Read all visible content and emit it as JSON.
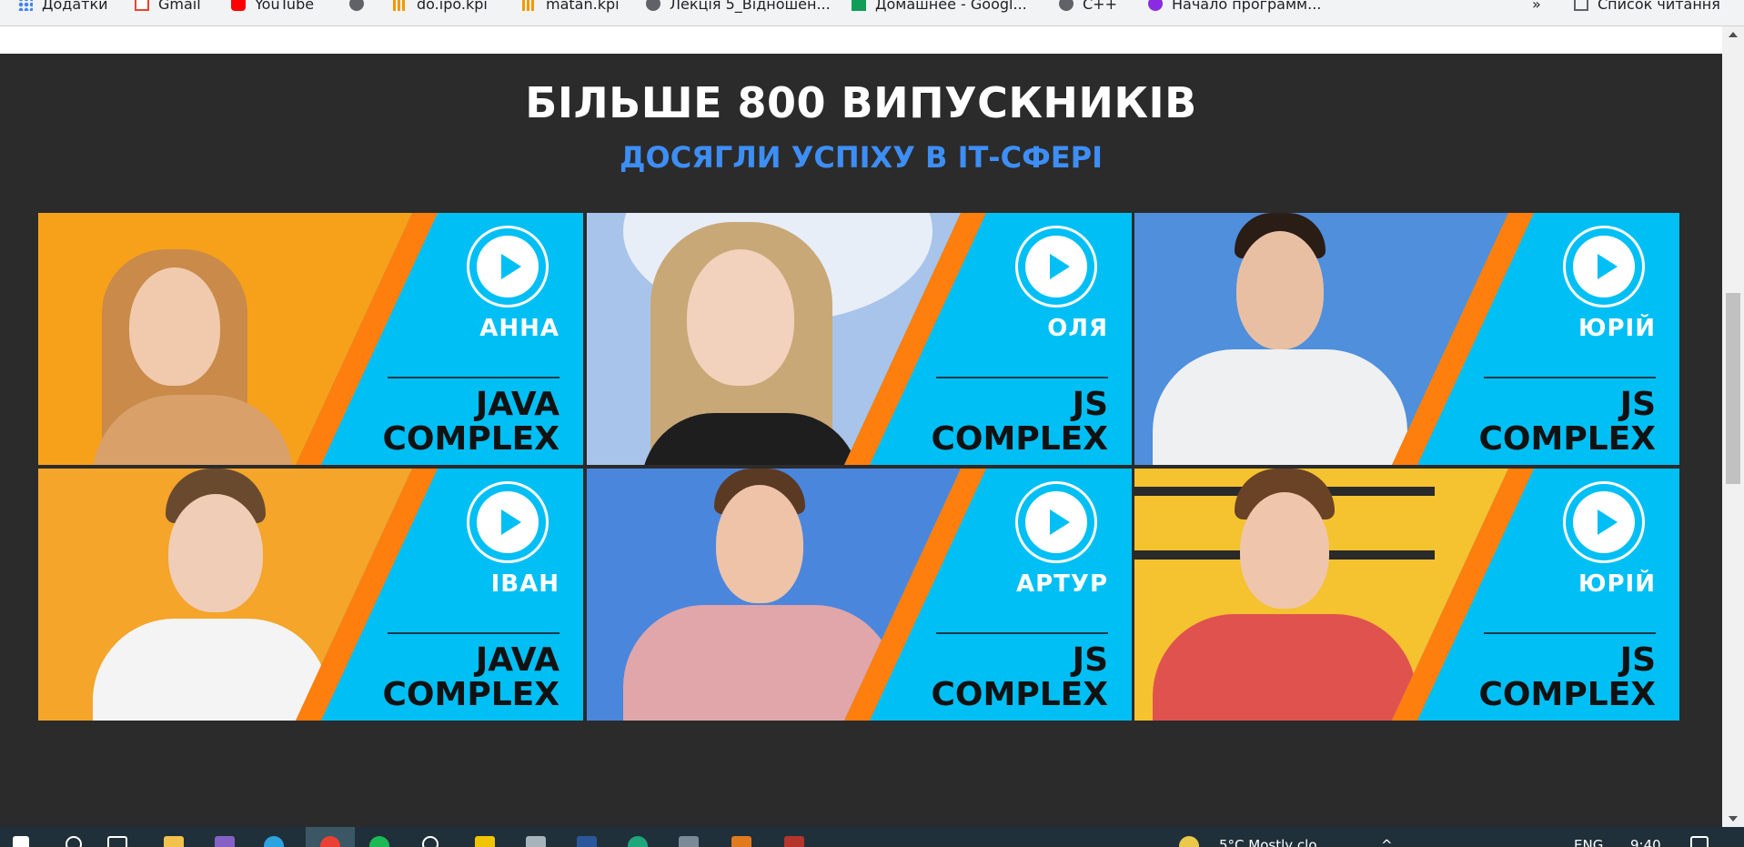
{
  "bookmarks": [
    {
      "label": "Додатки",
      "icon": "apps-grid-icon"
    },
    {
      "label": "Gmail",
      "icon": "gmail-icon"
    },
    {
      "label": "YouTube",
      "icon": "youtube-icon"
    },
    {
      "label": "",
      "icon": "globe-icon"
    },
    {
      "label": "do.ipo.kpi",
      "icon": "moodle-icon"
    },
    {
      "label": "matan.kpi",
      "icon": "moodle-icon"
    },
    {
      "label": "Лекція 5_Відношен...",
      "icon": "globe-icon"
    },
    {
      "label": "Домашнее - Googl...",
      "icon": "google-sheets-icon"
    },
    {
      "label": "C++",
      "icon": "cpp-icon"
    },
    {
      "label": "Начало программ...",
      "icon": "purple-circle-icon"
    }
  ],
  "bookmarks_more": "»",
  "reading_list": "Список читання",
  "heading": {
    "title": "БІЛЬШЕ 800 ВИПУСКНИКІВ",
    "subtitle": "ДОСЯГЛИ УСПІХУ В ІТ-СФЕРІ"
  },
  "colors": {
    "background": "#2b2b2b",
    "subtitle": "#3d8ef5",
    "card_blue": "#00bff4",
    "stripe_orange": "#ff7f0e"
  },
  "graduates": [
    {
      "name": "АННА",
      "course_line1": "JAVA",
      "course_line2": "COMPLEX",
      "photo_bg": "#f7a11a"
    },
    {
      "name": "ОЛЯ",
      "course_line1": "JS",
      "course_line2": "COMPLEX",
      "photo_bg": "#a9c4ea"
    },
    {
      "name": "ЮРІЙ",
      "course_line1": "JS",
      "course_line2": "COMPLEX",
      "photo_bg": "#4f8fdc"
    },
    {
      "name": "ІВАН",
      "course_line1": "JAVA",
      "course_line2": "COMPLEX",
      "photo_bg": "#f4a52a"
    },
    {
      "name": "АРТУР",
      "course_line1": "JS",
      "course_line2": "COMPLEX",
      "photo_bg": "#4b86dd"
    },
    {
      "name": "ЮРІЙ",
      "course_line1": "JS",
      "course_line2": "COMPLEX",
      "photo_bg": "#f5c230"
    }
  ],
  "taskbar": {
    "weather": "5°C  Mostly clo",
    "language": "ENG",
    "time": "9:40"
  }
}
